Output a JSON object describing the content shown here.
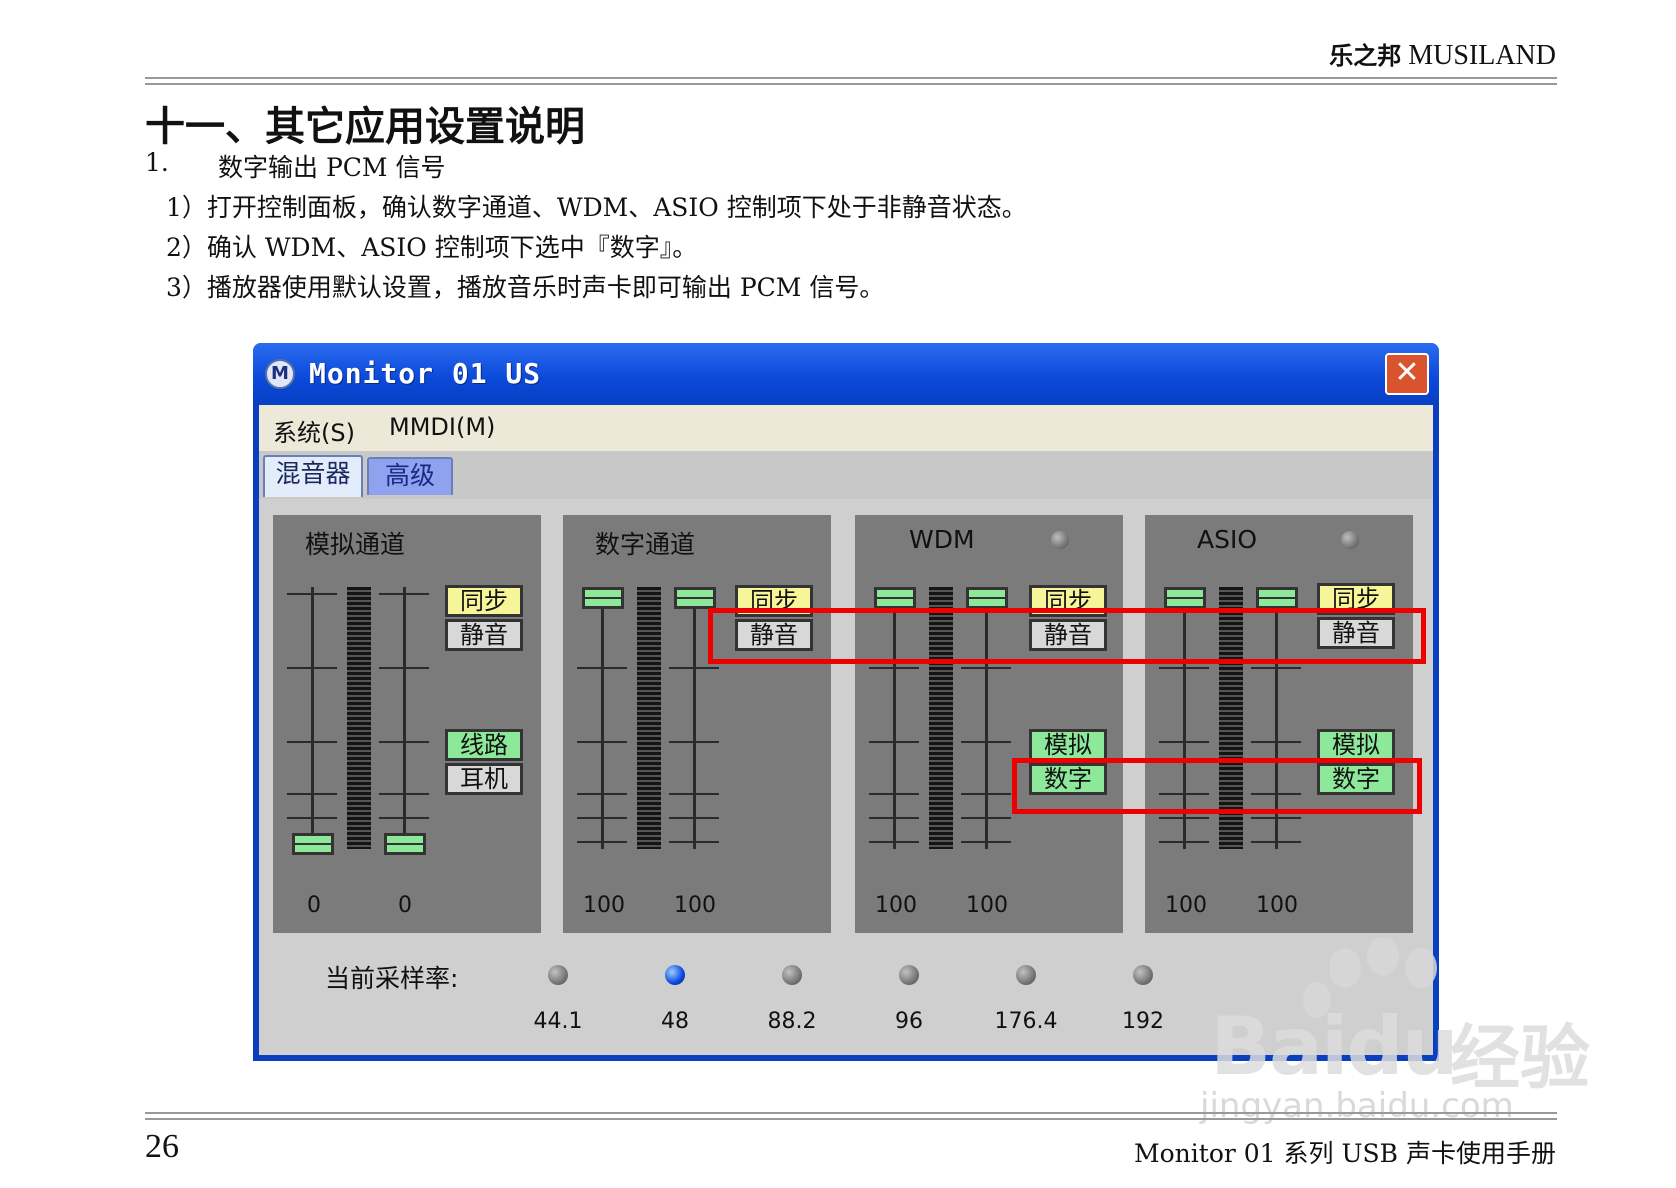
{
  "header": {
    "brand_cn": "乐之邦",
    "brand_en": "MUSILAND"
  },
  "section_title": "十一、其它应用设置说明",
  "item": {
    "number": "1.",
    "title": "数字输出 PCM 信号"
  },
  "steps": [
    "1）打开控制面板，确认数字通道、WDM、ASIO 控制项下处于非静音状态。",
    "2）确认 WDM、ASIO 控制项下选中『数字』。",
    "3）播放器使用默认设置，播放音乐时声卡即可输出 PCM 信号。"
  ],
  "window": {
    "title": "Monitor 01 US",
    "icon": "M",
    "close_label": "✕",
    "menus": [
      "系统(S)",
      "MMDI(M)"
    ],
    "tabs": [
      "混音器",
      "高级"
    ],
    "panels": [
      {
        "title": "模拟通道",
        "buttons": [
          "同步",
          "静音",
          "线路",
          "耳机"
        ],
        "values": [
          "0",
          "0"
        ]
      },
      {
        "title": "数字通道",
        "buttons": [
          "同步",
          "静音"
        ],
        "values": [
          "100",
          "100"
        ]
      },
      {
        "title": "WDM",
        "buttons": [
          "同步",
          "静音",
          "模拟",
          "数字"
        ],
        "values": [
          "100",
          "100"
        ]
      },
      {
        "title": "ASIO",
        "buttons": [
          "同步",
          "静音",
          "模拟",
          "数字"
        ],
        "values": [
          "100",
          "100"
        ]
      }
    ],
    "sample_rate_label": "当前采样率:",
    "sample_rates": [
      "44.1",
      "48",
      "88.2",
      "96",
      "176.4",
      "192"
    ],
    "active_rate": "48"
  },
  "watermark": {
    "logo": "Baidu",
    "cn": "经验",
    "url": "jingyan.baidu.com"
  },
  "footer": {
    "page": "26",
    "title": "Monitor 01 系列 USB 声卡使用手册"
  }
}
